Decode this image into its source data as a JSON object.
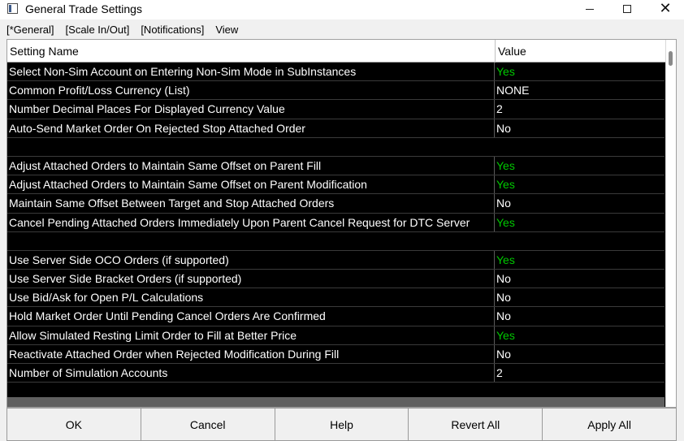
{
  "window": {
    "title": "General Trade Settings",
    "minimize_icon": "minimize-icon",
    "maximize_icon": "maximize-icon",
    "close_icon": "close-icon"
  },
  "menu": {
    "items": [
      "[*General]",
      "[Scale In/Out]",
      "[Notifications]",
      "View"
    ]
  },
  "grid": {
    "header_name": "Setting Name",
    "header_value": "Value",
    "rows": [
      {
        "name": "Select Non-Sim Account on Entering Non-Sim Mode in SubInstances",
        "value": "Yes"
      },
      {
        "name": "Common Profit/Loss Currency (List)",
        "value": "NONE"
      },
      {
        "name": "Number Decimal Places For Displayed Currency Value",
        "value": "2"
      },
      {
        "name": "Auto-Send Market Order On Rejected Stop Attached Order",
        "value": "No"
      },
      {
        "name": "",
        "value": ""
      },
      {
        "name": "Adjust Attached Orders to Maintain Same Offset on Parent Fill",
        "value": "Yes"
      },
      {
        "name": "Adjust Attached Orders to Maintain Same Offset on Parent Modification",
        "value": "Yes"
      },
      {
        "name": "Maintain Same Offset Between Target and Stop Attached Orders",
        "value": "No"
      },
      {
        "name": "Cancel Pending Attached Orders Immediately Upon Parent Cancel Request for DTC Server",
        "value": "Yes"
      },
      {
        "name": "",
        "value": ""
      },
      {
        "name": "Use Server Side OCO Orders (if supported)",
        "value": "Yes"
      },
      {
        "name": "Use Server Side Bracket Orders (if supported)",
        "value": "No"
      },
      {
        "name": "Use Bid/Ask for Open P/L Calculations",
        "value": "No"
      },
      {
        "name": "Hold Market Order Until Pending Cancel Orders Are Confirmed",
        "value": "No"
      },
      {
        "name": "Allow Simulated Resting Limit Order to Fill at Better Price",
        "value": "Yes"
      },
      {
        "name": "Reactivate Attached Order when Rejected Modification During Fill",
        "value": "No"
      },
      {
        "name": "Number of Simulation Accounts",
        "value": "2"
      },
      {
        "name": "",
        "value": ""
      }
    ],
    "yes_color": "#00c800",
    "row_text_color": "#ffffff",
    "background_color": "#000000"
  },
  "buttons": {
    "ok": "OK",
    "cancel": "Cancel",
    "help": "Help",
    "revert_all": "Revert All",
    "apply_all": "Apply All"
  }
}
